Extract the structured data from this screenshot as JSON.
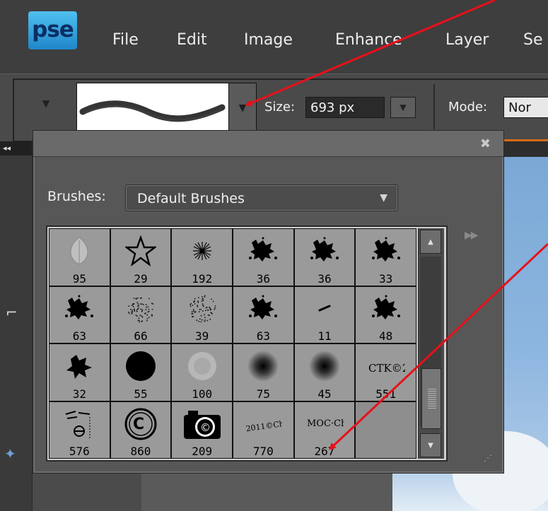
{
  "app": {
    "logo_text": "pse",
    "menu": [
      "File",
      "Edit",
      "Image",
      "Enhance",
      "Layer",
      "Se"
    ]
  },
  "options_bar": {
    "size_label": "Size:",
    "size_value": "693 px",
    "mode_label": "Mode:",
    "mode_value": "Nor"
  },
  "popup": {
    "close_glyph": "✖",
    "brushes_label": "Brushes:",
    "brushes_value": "Default Brushes",
    "flyout_glyph": "▶▶",
    "brushes": [
      {
        "size": "95",
        "thumb": "leaf"
      },
      {
        "size": "29",
        "thumb": "star"
      },
      {
        "size": "192",
        "thumb": "starburst"
      },
      {
        "size": "36",
        "thumb": "scatter-dark"
      },
      {
        "size": "36",
        "thumb": "scatter-dark"
      },
      {
        "size": "33",
        "thumb": "scatter-dark"
      },
      {
        "size": "63",
        "thumb": "scatter-dark"
      },
      {
        "size": "66",
        "thumb": "speckle"
      },
      {
        "size": "39",
        "thumb": "speckle"
      },
      {
        "size": "63",
        "thumb": "scatter-dark"
      },
      {
        "size": "11",
        "thumb": "dash"
      },
      {
        "size": "48",
        "thumb": "scatter-dark"
      },
      {
        "size": "32",
        "thumb": "splat"
      },
      {
        "size": "55",
        "thumb": "hard-round"
      },
      {
        "size": "100",
        "thumb": "speckle-light"
      },
      {
        "size": "75",
        "thumb": "soft-round"
      },
      {
        "size": "45",
        "thumb": "soft-round"
      },
      {
        "size": "551",
        "thumb": "stamp-text"
      },
      {
        "size": "576",
        "thumb": "ornament"
      },
      {
        "size": "860",
        "thumb": "copyright"
      },
      {
        "size": "209",
        "thumb": "camera"
      },
      {
        "size": "770",
        "thumb": "stamp-text-2"
      },
      {
        "size": "267",
        "thumb": "stamp-text-3"
      }
    ]
  },
  "colors": {
    "annotation_arrow": "#e8101a",
    "accent_orange": "#d86b17"
  }
}
